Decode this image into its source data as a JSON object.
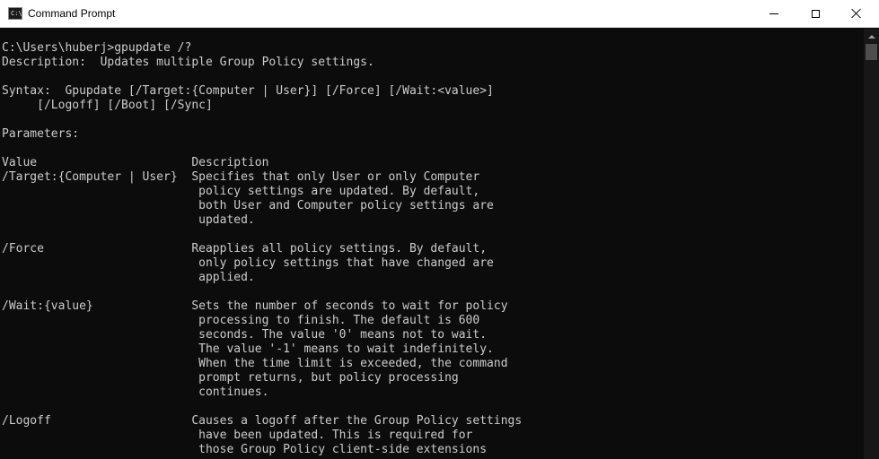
{
  "window": {
    "title": "Command Prompt",
    "icon": "cmd-icon",
    "icon_text": "C:\\",
    "controls": [
      "minimize",
      "maximize",
      "close"
    ]
  },
  "console": {
    "lines": [
      "C:\\Users\\huberj>gpupdate /?",
      "Description:  Updates multiple Group Policy settings.",
      "",
      "Syntax:  Gpupdate [/Target:{Computer | User}] [/Force] [/Wait:<value>]",
      "     [/Logoff] [/Boot] [/Sync]",
      "",
      "Parameters:",
      "",
      "Value                      Description",
      "/Target:{Computer | User}  Specifies that only User or only Computer",
      "                            policy settings are updated. By default,",
      "                            both User and Computer policy settings are",
      "                            updated.",
      "",
      "/Force                     Reapplies all policy settings. By default,",
      "                            only policy settings that have changed are",
      "                            applied.",
      "",
      "/Wait:{value}              Sets the number of seconds to wait for policy",
      "                            processing to finish. The default is 600",
      "                            seconds. The value '0' means not to wait.",
      "                            The value '-1' means to wait indefinitely.",
      "                            When the time limit is exceeded, the command",
      "                            prompt returns, but policy processing",
      "                            continues.",
      "",
      "/Logoff                    Causes a logoff after the Group Policy settings",
      "                            have been updated. This is required for",
      "                            those Group Policy client-side extensions"
    ]
  },
  "colors": {
    "console_bg": "#0c0c0c",
    "console_fg": "#cccccc",
    "titlebar_bg": "#ffffff"
  }
}
